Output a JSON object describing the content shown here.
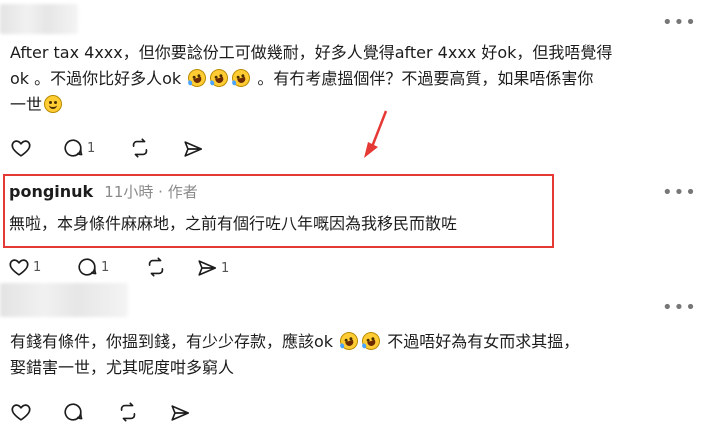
{
  "comment1": {
    "line1": "After tax 4xxx，但你要諗份工可做幾耐，好多人覺得after 4xxx 好ok，但我唔覺得",
    "line2a": "ok 。不過你比好多人ok",
    "line2b": "。有冇考慮搵個伴？不過要高質，如果唔係害你",
    "line3": "一世",
    "reply_count": "1"
  },
  "comment2": {
    "username": "ponginuk",
    "meta": "11小時 · 作者",
    "text": "無啦，本身條件麻麻地，之前有個行咗八年嘅因為我移民而散咗",
    "like_count": "1",
    "reply_count": "1",
    "share_count": "1"
  },
  "comment3": {
    "line1a": "有錢有條件，你搵到錢，有少少存款，應該ok",
    "line1b": "不過唔好為有女而求其搵，",
    "line2": "娶錯害一世，尤其呢度咁多窮人"
  },
  "more_label": "•••",
  "colors": {
    "highlight": "#e53935",
    "text": "#1c1c1c",
    "muted": "#8a8a8a"
  },
  "icons": [
    "heart-icon",
    "comment-icon",
    "repost-icon",
    "share-icon",
    "more-icon",
    "arrow-icon",
    "emoji-rofl-icon",
    "emoji-smile-icon"
  ]
}
